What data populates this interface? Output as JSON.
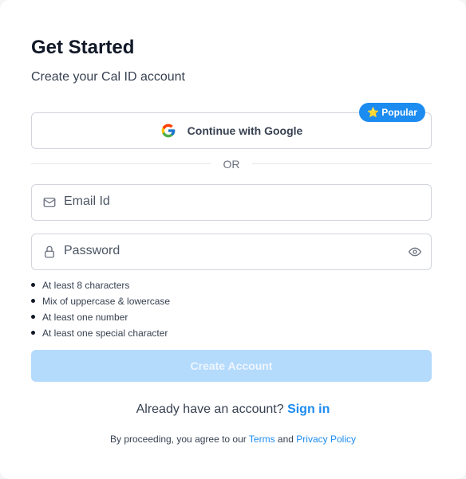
{
  "header": {
    "title": "Get Started",
    "subtitle": "Create your Cal ID account"
  },
  "google_button": {
    "label": "Continue with Google",
    "icon": "google-g-icon",
    "badge_label": "⭐ Popular"
  },
  "divider": {
    "text": "OR"
  },
  "email_field": {
    "label": "Email Id",
    "icon": "mail-icon"
  },
  "password_field": {
    "label": "Password",
    "icon": "lock-icon",
    "toggle_icon": "eye-icon"
  },
  "password_requirements": [
    "At least 8 characters",
    "Mix of uppercase & lowercase",
    "At least one number",
    "At least one special character"
  ],
  "create_button": {
    "label": "Create Account"
  },
  "signin": {
    "prompt": "Already have an account?",
    "link": "Sign in"
  },
  "terms": {
    "prefix": "By proceeding, you agree to our",
    "terms_link": "Terms",
    "conjunction": "and",
    "privacy_link": "Privacy Policy"
  },
  "colors": {
    "accent": "#1d8cf0",
    "button_disabled": "#b4dafc",
    "border": "#d1d5db"
  }
}
